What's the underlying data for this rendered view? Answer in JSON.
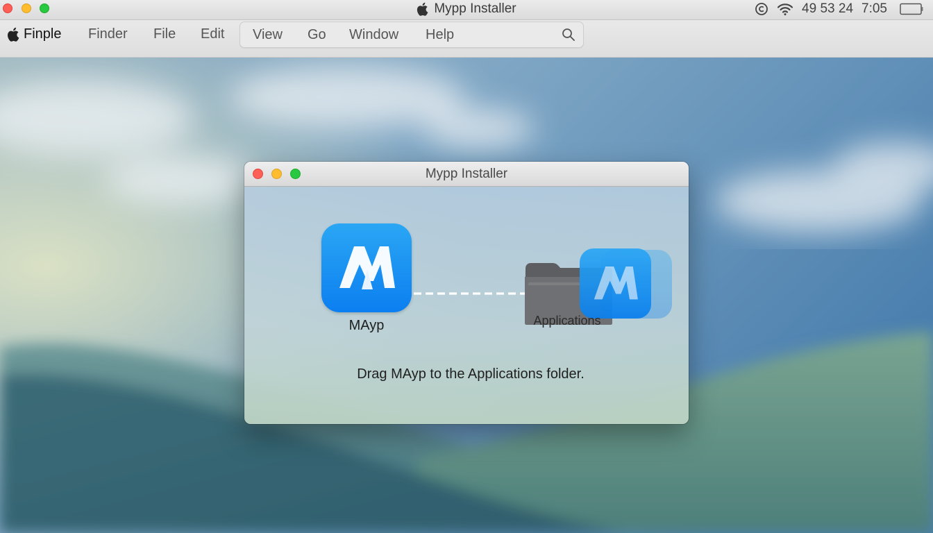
{
  "window_title": "Mypp Installer",
  "status_bar": {
    "numbers": "49 53 24",
    "time": "7:05",
    "icons": [
      "c-circle-icon",
      "wifi-icon",
      "battery-icon"
    ]
  },
  "menubar": {
    "app_name": "Finple",
    "items": [
      "Finder",
      "File",
      "Edit",
      "View",
      "Go",
      "Window",
      "Help"
    ]
  },
  "installer": {
    "title": "Mypp Installer",
    "app_label": "MAyp",
    "folder_label": "Applications",
    "instruction": "Drag MAyp to the Applications folder.",
    "app_icon_color": "#1a90f2"
  }
}
